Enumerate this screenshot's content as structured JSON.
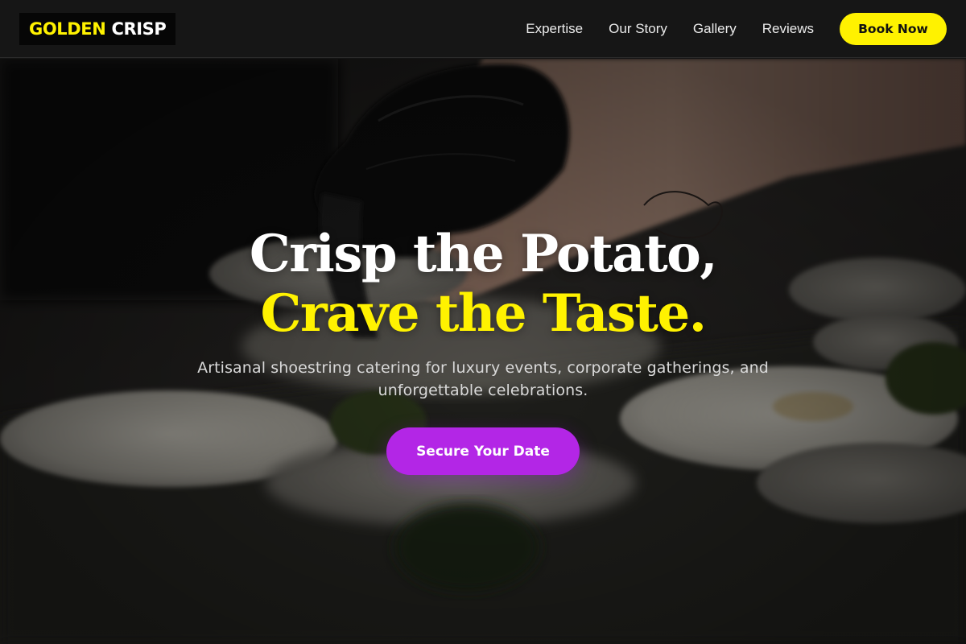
{
  "brand": {
    "part1": "GOLDEN",
    "part2": "CRISP",
    "accent_color": "#fff200"
  },
  "nav": {
    "links": [
      "Expertise",
      "Our Story",
      "Gallery",
      "Reviews"
    ],
    "cta_label": "Book Now"
  },
  "hero": {
    "headline_line1": "Crisp the Potato,",
    "headline_line2": "Crave the Taste.",
    "subtitle": "Artisanal shoestring catering for luxury events, corporate gatherings, and unforgettable celebrations.",
    "cta_label": "Secure Your Date",
    "cta_color": "#b326e6",
    "background_image": "chef-in-black-glove-plating-dishes-photo"
  }
}
